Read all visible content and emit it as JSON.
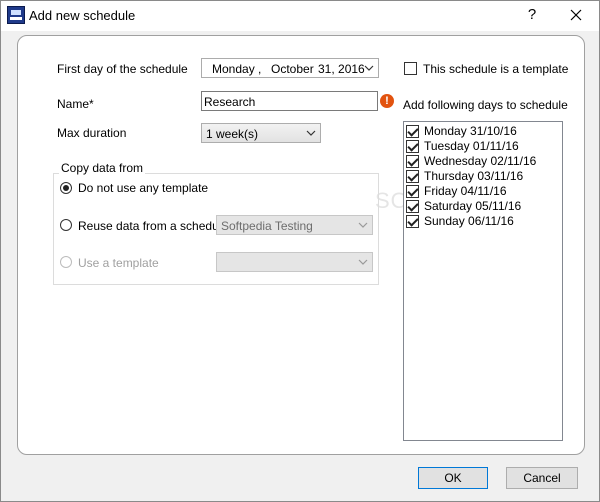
{
  "window": {
    "title": "Add new schedule",
    "help_label": "?"
  },
  "form": {
    "first_day_label": "First day of the schedule",
    "first_day": {
      "weekday": "Monday",
      "separator": ",",
      "month": "October",
      "day_year": "31, 2016"
    },
    "name_label": "Name*",
    "name_value": "Research",
    "max_duration_label": "Max duration",
    "max_duration_value": "1 week(s)",
    "template_checkbox_label": "This schedule is a template",
    "add_days_label": "Add following days to schedule"
  },
  "copy_data": {
    "legend": "Copy data from",
    "option_none": "Do not use any template",
    "option_reuse": "Reuse data from a schedule",
    "reuse_value": "Softpedia Testing",
    "option_template": "Use a template",
    "template_value": ""
  },
  "days": [
    {
      "label": "Monday 31/10/16",
      "checked": true
    },
    {
      "label": "Tuesday 01/11/16",
      "checked": true
    },
    {
      "label": "Wednesday 02/11/16",
      "checked": true
    },
    {
      "label": "Thursday 03/11/16",
      "checked": true
    },
    {
      "label": "Friday 04/11/16",
      "checked": true
    },
    {
      "label": "Saturday 05/11/16",
      "checked": true
    },
    {
      "label": "Sunday 06/11/16",
      "checked": true
    }
  ],
  "buttons": {
    "ok": "OK",
    "cancel": "Cancel"
  },
  "watermark": "SOFTPEDIA"
}
